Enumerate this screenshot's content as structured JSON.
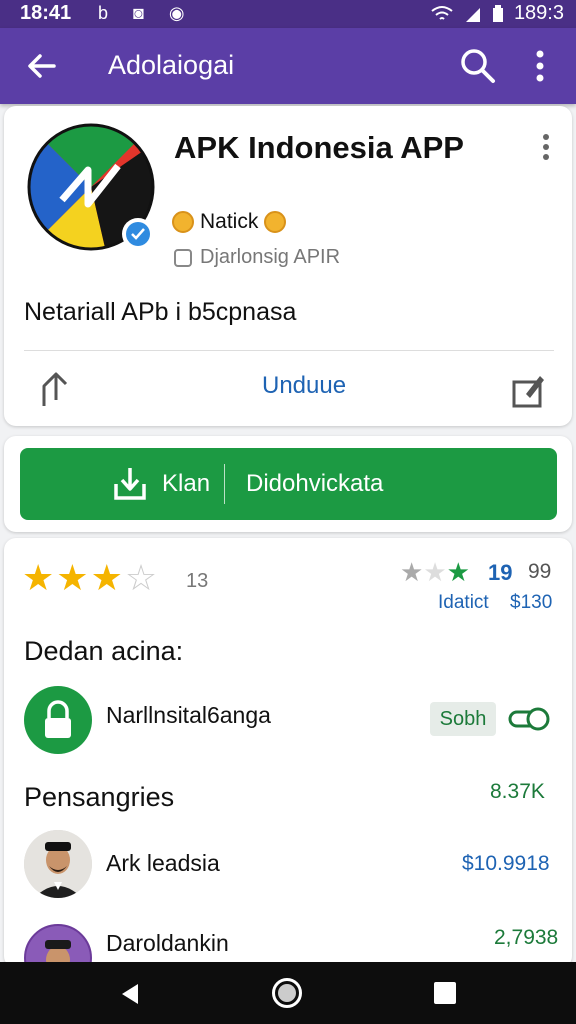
{
  "status_bar": {
    "time": "18:41",
    "icons_left": "b ◙ ◉",
    "right_text": "189:3"
  },
  "app_bar": {
    "title": "Adolaiogai"
  },
  "app_card": {
    "title": "APK Indonesia APP",
    "developer": "Natick",
    "subtitle": "Djarlonsig APIR",
    "description": "Netariall APb i b5cpnasa",
    "action_label": "Unduue"
  },
  "install_button": {
    "label_left": "Klan",
    "label_right": "Didohvickata"
  },
  "rating": {
    "filled_stars": 3,
    "total_stars": 4,
    "count": "13",
    "stat_primary": "19",
    "stat_secondary": "99",
    "sub_label": "Idatict",
    "sub_value": "$130"
  },
  "section_detail": {
    "title": "Dedan acina:",
    "item_label": "Narllnsital6anga",
    "chip_label": "Sobh"
  },
  "section_people": {
    "title": "Pensangries",
    "value": "8.37K",
    "rows": [
      {
        "name": "Ark leadsia",
        "value": "$10.9918"
      },
      {
        "name": "Daroldankin",
        "value": "2,7938"
      }
    ]
  },
  "colors": {
    "app_bar": "#5b3ea6",
    "status_bar": "#4a2f86",
    "install": "#1c9a43",
    "link": "#1e63b3"
  },
  "icons": [
    "back-arrow-icon",
    "search-icon",
    "more-vert-icon",
    "verified-badge-icon",
    "coin-icon",
    "share-icon",
    "edit-icon",
    "download-icon",
    "star-icon",
    "lock-icon",
    "toggle-icon"
  ]
}
